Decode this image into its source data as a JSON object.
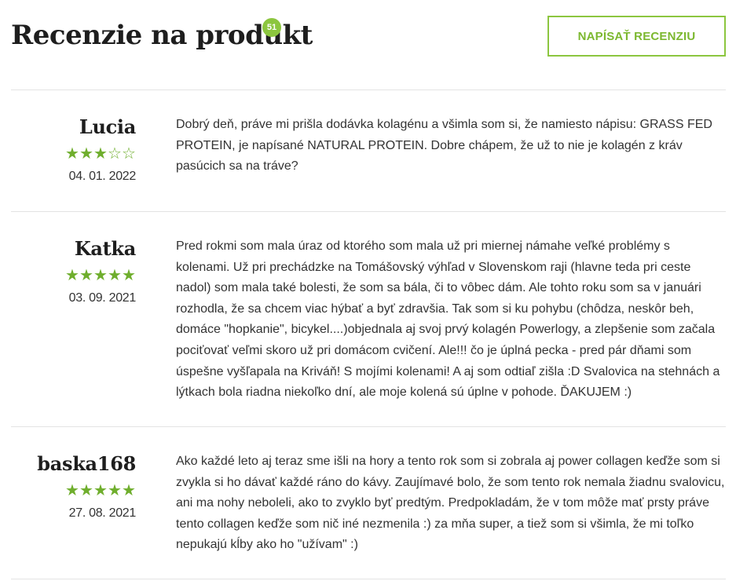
{
  "header": {
    "title": "Recenzie na produkt",
    "count": "51",
    "write_button": "NAPÍSAŤ RECENZIU"
  },
  "colors": {
    "accent": "#8cc63f",
    "star": "#6fae2d"
  },
  "reviews": [
    {
      "name": "Lucia",
      "rating": 3,
      "max_rating": 5,
      "date": "04. 01. 2022",
      "text": "Dobrý deň, práve mi prišla dodávka kolagénu a všimla som si, že namiesto nápisu: GRASS FED PROTEIN, je napísané NATURAL PROTEIN. Dobre chápem, že už to nie je kolagén z kráv pasúcich sa na tráve?"
    },
    {
      "name": "Katka",
      "rating": 5,
      "max_rating": 5,
      "date": "03. 09. 2021",
      "text": "Pred rokmi som mala úraz od ktorého som mala už pri miernej námahe veľké problémy s kolenami. Už pri prechádzke na Tomášovský výhľad v Slovenskom raji (hlavne teda pri ceste nadol) som mala také bolesti, že som sa bála, či to vôbec dám. Ale tohto roku som sa v januári rozhodla, že sa chcem viac hýbať a byť zdravšia. Tak som si ku pohybu (chôdza, neskôr beh, domáce \"hopkanie\", bicykel....)objednala aj svoj prvý kolagén Powerlogy, a zlepšenie som začala pociťovať veľmi skoro už pri domácom cvičení. Ale!!! čo je úplná pecka - pred pár dňami som úspešne vyšľapala na Kriváň! S mojími kolenami! A aj som odtiaľ zišla :D Svalovica na stehnách a lýtkach bola riadna niekoľko dní, ale moje kolená sú úplne v pohode. ĎAKUJEM :)"
    },
    {
      "name": "baska168",
      "rating": 5,
      "max_rating": 5,
      "date": "27. 08. 2021",
      "text": "Ako každé leto aj teraz sme išli na hory a tento rok som si zobrala aj power collagen keďže som si zvykla si ho dávať každé ráno do kávy. Zaujímavé bolo, že som tento rok nemala žiadnu svalovicu, ani ma nohy neboleli, ako to zvyklo byť predtým. Predpokladám, že v tom môže mať prsty práve tento collagen keďže som nič iné nezmenila :) za mňa super, a tiež som si všimla, že mi toľko nepukajú kĺby ako ho \"užívam\" :)"
    }
  ]
}
